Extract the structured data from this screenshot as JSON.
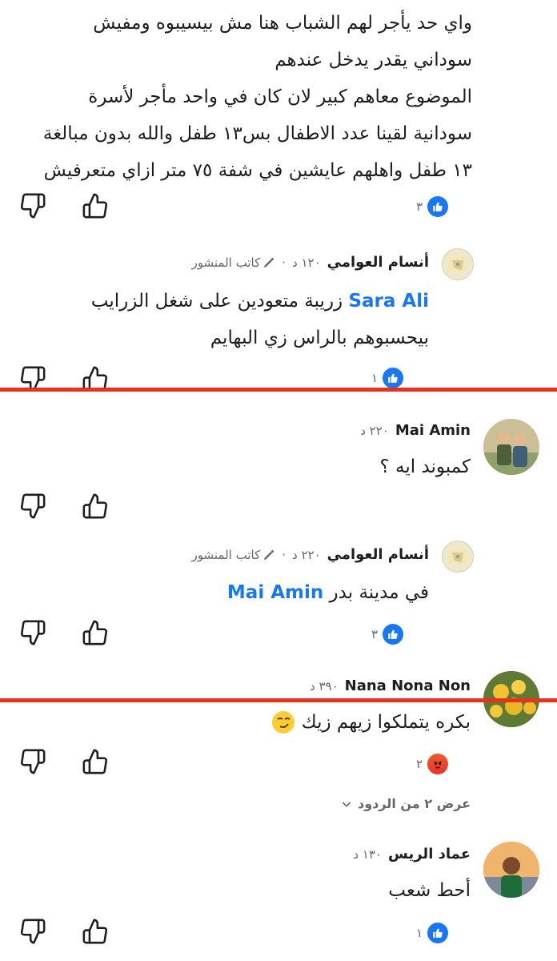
{
  "comment1": {
    "lines": [
      "واي حد يأجر لهم  الشباب هنا مش بيسيبوه ومفيش",
      "سوداني يقدر يدخل عندهم",
      "الموضوع معاهم كبير لان كان في واحد مأجر لأسرة",
      "سودانية لقينا عدد الاطفال بس١٣ طفل والله بدون مبالغة",
      "١٣ طفل واهلهم عايشين في شفة ٧٥  متر ازاي متعرفيش"
    ],
    "reaction_count": "٣"
  },
  "reply1": {
    "name": "أنسام العوامي",
    "time": "١٢٠ د",
    "author_badge": "كاتب المنشور",
    "mention": "Sara Ali",
    "line1_text": " زريبة متعودين على شغل الزرايب",
    "line2_text": "بيحسبوهم بالراس زي البهايم",
    "reaction_count": "١"
  },
  "comment2": {
    "name": "Mai Amin",
    "time": "٢٢٠ د",
    "text": "كمبوند ايه ؟"
  },
  "reply2": {
    "name": "أنسام العوامي",
    "time": "٢٢٠ د",
    "author_badge": "كاتب المنشور",
    "mention": "Mai Amin",
    "text": "في مدينة بدر ",
    "reaction_count": "٣"
  },
  "comment3": {
    "name": "Nana Nona Non",
    "time": "٣٩٠ د",
    "text": "بكره يتملكوا زيهم زيك",
    "reaction_count": "٢",
    "view_replies": "عرض ٢ من الردود"
  },
  "comment4": {
    "name": "عماد الريس",
    "time": "١٣٠ د",
    "text": "أحط شعب",
    "reaction_count": "١"
  },
  "colors": {
    "link_blue": "#1877f2",
    "meta_gray": "#65676b",
    "red_marker": "#e8321e"
  }
}
